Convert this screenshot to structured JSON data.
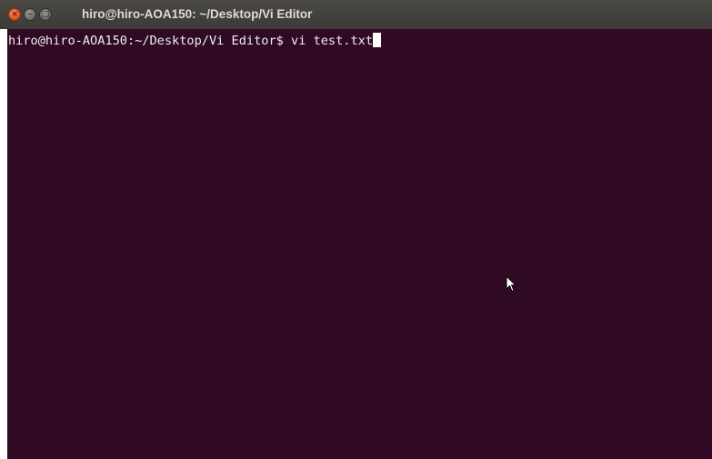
{
  "window": {
    "title": "hiro@hiro-AOA150: ~/Desktop/Vi Editor"
  },
  "terminal": {
    "prompt": "hiro@hiro-AOA150:~/Desktop/Vi Editor$",
    "command": " vi test.txt"
  },
  "icons": {
    "close": "close-icon",
    "minimize": "minimize-icon",
    "maximize": "maximize-icon",
    "cursor": "mouse-pointer-icon"
  },
  "colors": {
    "terminal_bg": "#300a24",
    "titlebar_bg": "#3c3b37",
    "close_button": "#e2561d",
    "text": "#eeeeec"
  }
}
